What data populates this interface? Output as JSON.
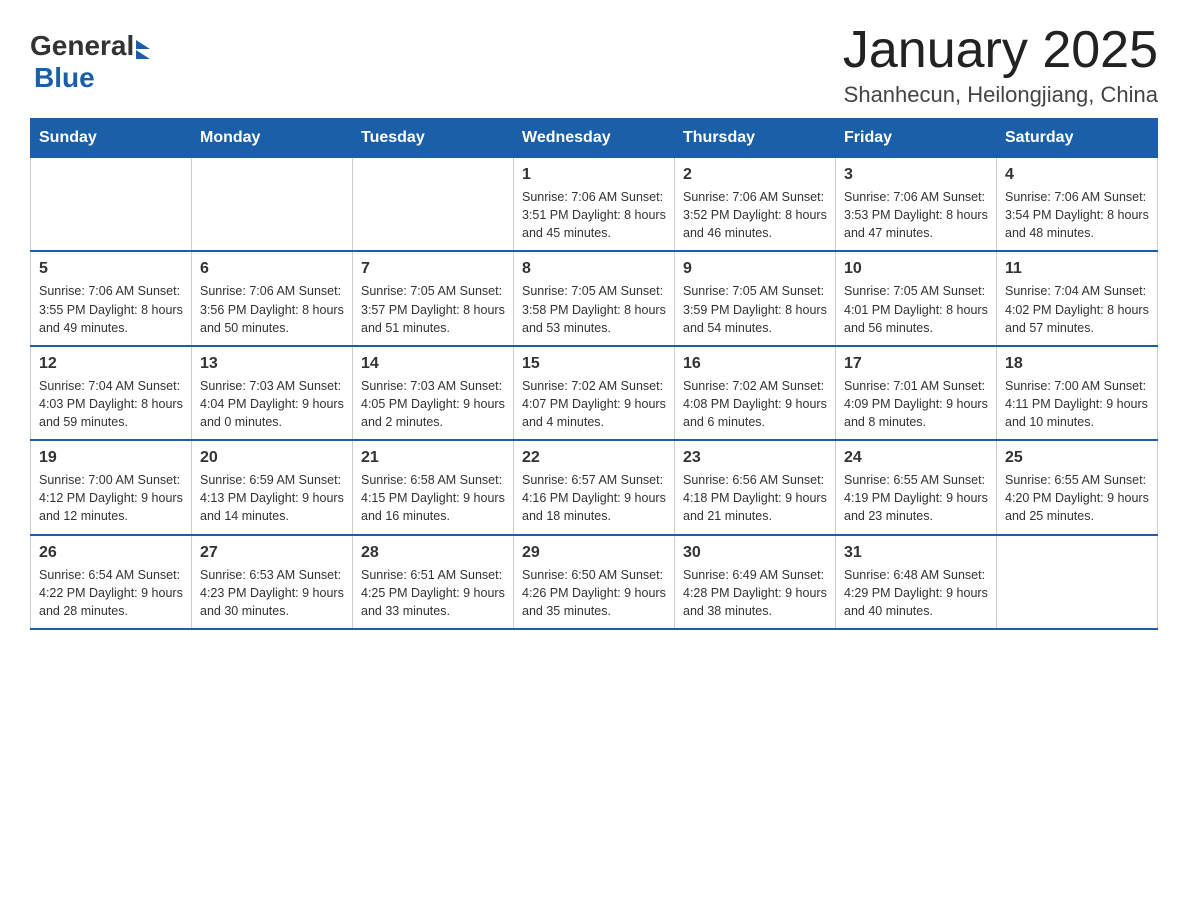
{
  "header": {
    "logo_general": "General",
    "logo_arrow": "▶",
    "logo_blue": "Blue",
    "month_title": "January 2025",
    "location": "Shanhecun, Heilongjiang, China"
  },
  "weekdays": [
    "Sunday",
    "Monday",
    "Tuesday",
    "Wednesday",
    "Thursday",
    "Friday",
    "Saturday"
  ],
  "weeks": [
    [
      {
        "day": "",
        "info": ""
      },
      {
        "day": "",
        "info": ""
      },
      {
        "day": "",
        "info": ""
      },
      {
        "day": "1",
        "info": "Sunrise: 7:06 AM\nSunset: 3:51 PM\nDaylight: 8 hours\nand 45 minutes."
      },
      {
        "day": "2",
        "info": "Sunrise: 7:06 AM\nSunset: 3:52 PM\nDaylight: 8 hours\nand 46 minutes."
      },
      {
        "day": "3",
        "info": "Sunrise: 7:06 AM\nSunset: 3:53 PM\nDaylight: 8 hours\nand 47 minutes."
      },
      {
        "day": "4",
        "info": "Sunrise: 7:06 AM\nSunset: 3:54 PM\nDaylight: 8 hours\nand 48 minutes."
      }
    ],
    [
      {
        "day": "5",
        "info": "Sunrise: 7:06 AM\nSunset: 3:55 PM\nDaylight: 8 hours\nand 49 minutes."
      },
      {
        "day": "6",
        "info": "Sunrise: 7:06 AM\nSunset: 3:56 PM\nDaylight: 8 hours\nand 50 minutes."
      },
      {
        "day": "7",
        "info": "Sunrise: 7:05 AM\nSunset: 3:57 PM\nDaylight: 8 hours\nand 51 minutes."
      },
      {
        "day": "8",
        "info": "Sunrise: 7:05 AM\nSunset: 3:58 PM\nDaylight: 8 hours\nand 53 minutes."
      },
      {
        "day": "9",
        "info": "Sunrise: 7:05 AM\nSunset: 3:59 PM\nDaylight: 8 hours\nand 54 minutes."
      },
      {
        "day": "10",
        "info": "Sunrise: 7:05 AM\nSunset: 4:01 PM\nDaylight: 8 hours\nand 56 minutes."
      },
      {
        "day": "11",
        "info": "Sunrise: 7:04 AM\nSunset: 4:02 PM\nDaylight: 8 hours\nand 57 minutes."
      }
    ],
    [
      {
        "day": "12",
        "info": "Sunrise: 7:04 AM\nSunset: 4:03 PM\nDaylight: 8 hours\nand 59 minutes."
      },
      {
        "day": "13",
        "info": "Sunrise: 7:03 AM\nSunset: 4:04 PM\nDaylight: 9 hours\nand 0 minutes."
      },
      {
        "day": "14",
        "info": "Sunrise: 7:03 AM\nSunset: 4:05 PM\nDaylight: 9 hours\nand 2 minutes."
      },
      {
        "day": "15",
        "info": "Sunrise: 7:02 AM\nSunset: 4:07 PM\nDaylight: 9 hours\nand 4 minutes."
      },
      {
        "day": "16",
        "info": "Sunrise: 7:02 AM\nSunset: 4:08 PM\nDaylight: 9 hours\nand 6 minutes."
      },
      {
        "day": "17",
        "info": "Sunrise: 7:01 AM\nSunset: 4:09 PM\nDaylight: 9 hours\nand 8 minutes."
      },
      {
        "day": "18",
        "info": "Sunrise: 7:00 AM\nSunset: 4:11 PM\nDaylight: 9 hours\nand 10 minutes."
      }
    ],
    [
      {
        "day": "19",
        "info": "Sunrise: 7:00 AM\nSunset: 4:12 PM\nDaylight: 9 hours\nand 12 minutes."
      },
      {
        "day": "20",
        "info": "Sunrise: 6:59 AM\nSunset: 4:13 PM\nDaylight: 9 hours\nand 14 minutes."
      },
      {
        "day": "21",
        "info": "Sunrise: 6:58 AM\nSunset: 4:15 PM\nDaylight: 9 hours\nand 16 minutes."
      },
      {
        "day": "22",
        "info": "Sunrise: 6:57 AM\nSunset: 4:16 PM\nDaylight: 9 hours\nand 18 minutes."
      },
      {
        "day": "23",
        "info": "Sunrise: 6:56 AM\nSunset: 4:18 PM\nDaylight: 9 hours\nand 21 minutes."
      },
      {
        "day": "24",
        "info": "Sunrise: 6:55 AM\nSunset: 4:19 PM\nDaylight: 9 hours\nand 23 minutes."
      },
      {
        "day": "25",
        "info": "Sunrise: 6:55 AM\nSunset: 4:20 PM\nDaylight: 9 hours\nand 25 minutes."
      }
    ],
    [
      {
        "day": "26",
        "info": "Sunrise: 6:54 AM\nSunset: 4:22 PM\nDaylight: 9 hours\nand 28 minutes."
      },
      {
        "day": "27",
        "info": "Sunrise: 6:53 AM\nSunset: 4:23 PM\nDaylight: 9 hours\nand 30 minutes."
      },
      {
        "day": "28",
        "info": "Sunrise: 6:51 AM\nSunset: 4:25 PM\nDaylight: 9 hours\nand 33 minutes."
      },
      {
        "day": "29",
        "info": "Sunrise: 6:50 AM\nSunset: 4:26 PM\nDaylight: 9 hours\nand 35 minutes."
      },
      {
        "day": "30",
        "info": "Sunrise: 6:49 AM\nSunset: 4:28 PM\nDaylight: 9 hours\nand 38 minutes."
      },
      {
        "day": "31",
        "info": "Sunrise: 6:48 AM\nSunset: 4:29 PM\nDaylight: 9 hours\nand 40 minutes."
      },
      {
        "day": "",
        "info": ""
      }
    ]
  ]
}
